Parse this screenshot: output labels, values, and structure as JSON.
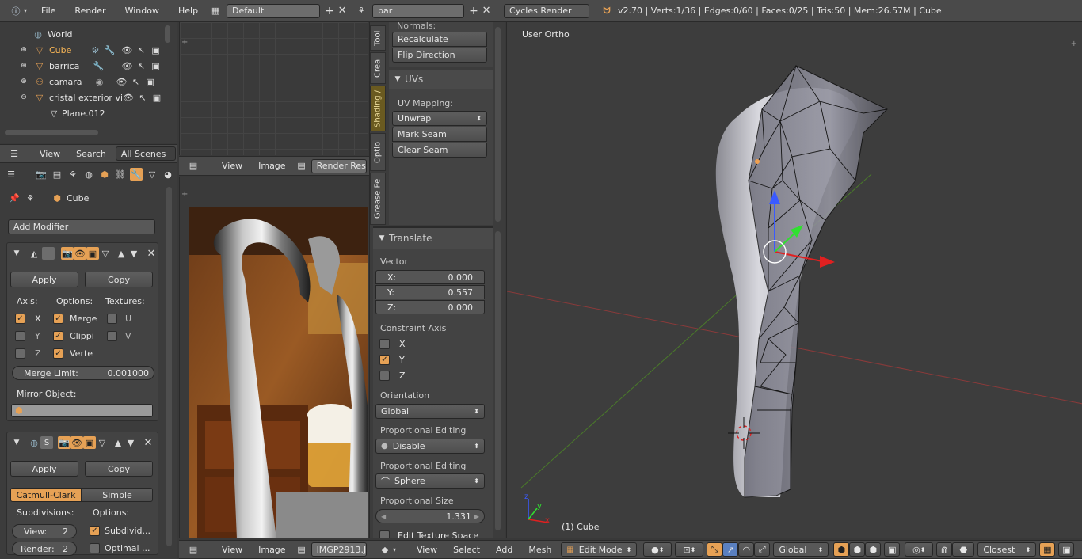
{
  "topbar": {
    "menus": [
      "File",
      "Render",
      "Window",
      "Help"
    ],
    "screen_layout": "Default",
    "scene": "bar",
    "render_engine": "Cycles Render",
    "stats": "v2.70 | Verts:1/36 | Edges:0/60 | Faces:0/25 | Tris:50 | Mem:26.57M | Cube"
  },
  "outliner": {
    "items": [
      {
        "label": "World",
        "icon": "world-icon"
      },
      {
        "label": "Cube",
        "icon": "mesh-icon"
      },
      {
        "label": "barrica",
        "icon": "mesh-icon"
      },
      {
        "label": "camara",
        "icon": "camera-icon"
      },
      {
        "label": "cristal exterior vi",
        "icon": "mesh-icon"
      },
      {
        "label": "Plane.012",
        "icon": "mesh-data-icon"
      }
    ],
    "header": {
      "view": "View",
      "search": "Search",
      "filter": "All Scenes"
    }
  },
  "properties": {
    "object_name": "Cube",
    "add_modifier": "Add Modifier",
    "mirror": {
      "apply": "Apply",
      "copy": "Copy",
      "axis_label": "Axis:",
      "options_label": "Options:",
      "textures_label": "Textures:",
      "x": "X",
      "y": "Y",
      "z": "Z",
      "merge": "Merge",
      "clipping": "Clippi",
      "vertex": "Verte",
      "u": "U",
      "v": "V",
      "merge_limit_label": "Merge Limit:",
      "merge_limit_value": "0.001000",
      "mirror_object_label": "Mirror Object:"
    },
    "subsurf": {
      "apply": "Apply",
      "copy": "Copy",
      "catmull": "Catmull-Clark",
      "simple": "Simple",
      "subdivisions_label": "Subdivisions:",
      "options_label": "Options:",
      "view_label": "View:",
      "view_value": "2",
      "render_label": "Render:",
      "render_value": "2",
      "subdivide_uvs": "Subdivid...",
      "optimal": "Optimal ..."
    }
  },
  "image_editor_top": {
    "view": "View",
    "image": "Image",
    "image_name": "Render Result"
  },
  "image_editor_bottom": {
    "view": "View",
    "image": "Image",
    "image_name": "IMGP2913.J"
  },
  "toolshelf": {
    "tabs": [
      "Tool",
      "Crea",
      "Shading /",
      "Optio",
      "Grease Pe"
    ],
    "normals_label": "Normals:",
    "recalculate": "Recalculate",
    "flip_direction": "Flip Direction",
    "uvs_title": "UVs",
    "uv_mapping_label": "UV Mapping:",
    "unwrap": "Unwrap",
    "mark_seam": "Mark Seam",
    "clear_seam": "Clear Seam"
  },
  "operator": {
    "title": "Translate",
    "vector_label": "Vector",
    "x_label": "X:",
    "x_value": "0.000",
    "y_label": "Y:",
    "y_value": "0.557",
    "z_label": "Z:",
    "z_value": "0.000",
    "constraint_label": "Constraint Axis",
    "cx": "X",
    "cy": "Y",
    "cz": "Z",
    "orientation_label": "Orientation",
    "orientation_value": "Global",
    "prop_edit_label": "Proportional Editing",
    "prop_edit_value": "Disable",
    "falloff_label": "Proportional Editing Falloff",
    "falloff_value": "Sphere",
    "prop_size_label": "Proportional Size",
    "prop_size_value": "1.331",
    "edit_texture_space": "Edit Texture Space"
  },
  "viewport": {
    "view_name": "User Ortho",
    "object_label": "(1) Cube",
    "menus": [
      "View",
      "Select",
      "Add",
      "Mesh"
    ],
    "mode": "Edit Mode",
    "orientation": "Global",
    "snap": "Closest"
  },
  "colors": {
    "accent": "#e6a155",
    "bg": "#393939",
    "header": "#4a4a4a",
    "viewport": "#3d3d3d"
  }
}
